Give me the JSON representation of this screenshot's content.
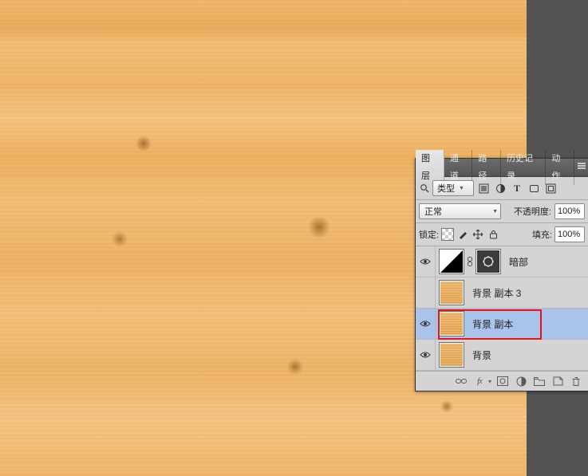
{
  "panel": {
    "tabs": {
      "layers": "图层",
      "channels": "通道",
      "paths": "路径",
      "history": "历史记录",
      "actions": "动作"
    },
    "filter": {
      "type_label": "类型"
    },
    "blend": {
      "mode": "正常",
      "opacity_label": "不透明度:",
      "opacity_value": "100%"
    },
    "lock": {
      "label": "锁定:",
      "fill_label": "填充:",
      "fill_value": "100%"
    },
    "layers": [
      {
        "name": "暗部",
        "visible": true,
        "selected": false,
        "kind": "adjustment"
      },
      {
        "name": "背景 副本 3",
        "visible": false,
        "selected": false,
        "kind": "wood"
      },
      {
        "name": "背景 副本",
        "visible": true,
        "selected": true,
        "kind": "wood"
      },
      {
        "name": "背景",
        "visible": true,
        "selected": false,
        "kind": "wood"
      }
    ],
    "footer_fx": "fx"
  }
}
